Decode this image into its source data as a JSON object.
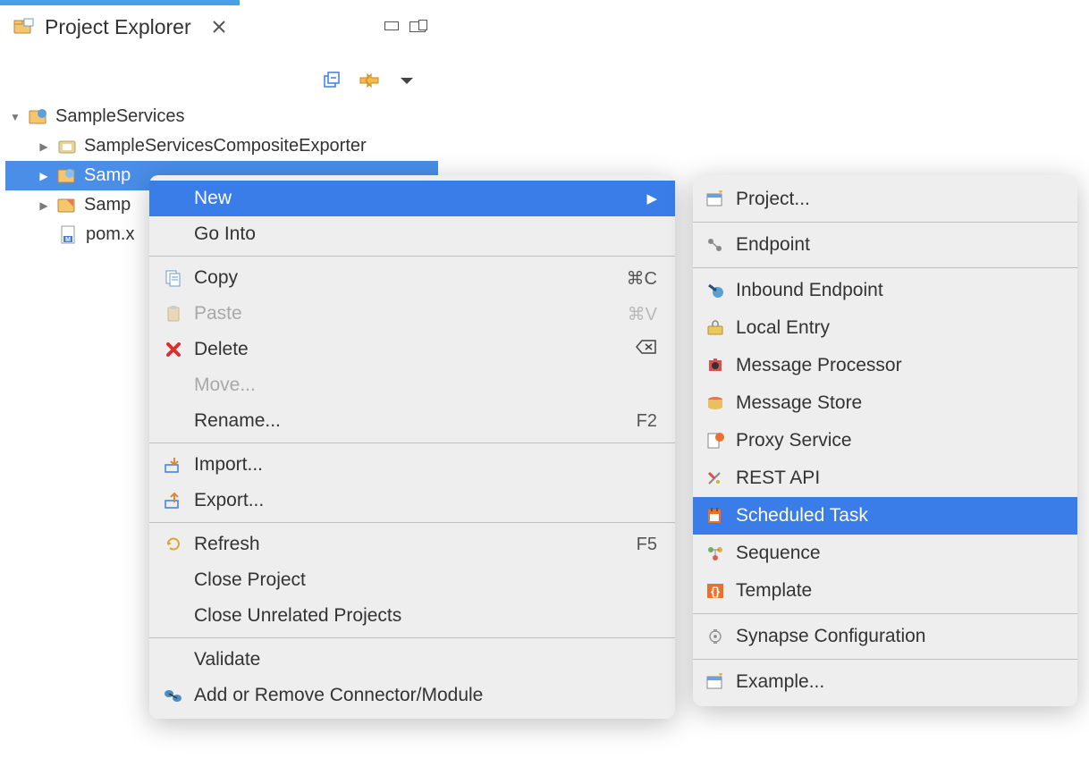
{
  "view": {
    "title": "Project Explorer"
  },
  "tree": {
    "root": "SampleServices",
    "items": [
      "SampleServicesCompositeExporter",
      "SampleServicesConfigs",
      "SampleServices...",
      "pom.xml"
    ],
    "selectedDisplay": "Samp",
    "truncated2": "Samp",
    "truncated3": "pom.x"
  },
  "context": {
    "new": "New",
    "goInto": "Go Into",
    "copy": "Copy",
    "copyAccel": "⌘C",
    "paste": "Paste",
    "pasteAccel": "⌘V",
    "delete": "Delete",
    "deleteAccel": "⌫",
    "move": "Move...",
    "rename": "Rename...",
    "renameAccel": "F2",
    "import": "Import...",
    "export": "Export...",
    "refresh": "Refresh",
    "refreshAccel": "F5",
    "closeProject": "Close Project",
    "closeUnrelated": "Close Unrelated Projects",
    "validate": "Validate",
    "addConnector": "Add or Remove Connector/Module"
  },
  "submenu": {
    "project": "Project...",
    "endpoint": "Endpoint",
    "inbound": "Inbound Endpoint",
    "localEntry": "Local Entry",
    "msgProcessor": "Message Processor",
    "msgStore": "Message Store",
    "proxy": "Proxy Service",
    "restApi": "REST API",
    "scheduled": "Scheduled Task",
    "sequence": "Sequence",
    "template": "Template",
    "synapse": "Synapse Configuration",
    "example": "Example..."
  }
}
